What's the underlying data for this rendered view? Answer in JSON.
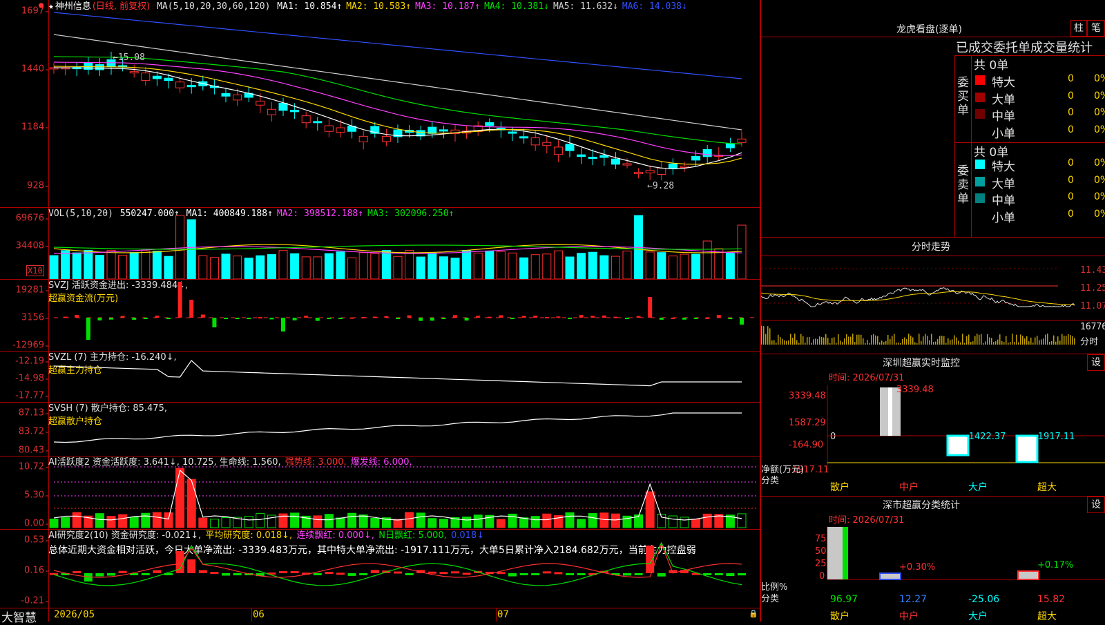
{
  "stock": {
    "name_prefix": "★",
    "name": "神州信息",
    "mode": "(日线, 前复权)",
    "ma_label": "MA(5,10,20,30,60,120)",
    "ma": [
      {
        "label": "MA1: 10.854↑",
        "color": "#ffffff"
      },
      {
        "label": "MA2: 10.583↑",
        "color": "#ffd800"
      },
      {
        "label": "MA3: 10.187↑",
        "color": "#ff40ff"
      },
      {
        "label": "MA4: 10.381↓",
        "color": "#00e000"
      },
      {
        "label": "MA5: 11.632↓",
        "color": "#d0d0d0"
      },
      {
        "label": "MA6: 14.038↓",
        "color": "#3050ff"
      }
    ],
    "high_label": "←15.08",
    "low_label": "←9.28",
    "price_ticks": [
      "1697",
      "1440",
      "1184",
      "928"
    ]
  },
  "vol": {
    "title": "VOL(5,10,20)",
    "value": "550247.000↑",
    "ma": [
      {
        "label": "MA1: 400849.188↑",
        "color": "#ffffff"
      },
      {
        "label": "MA2: 398512.188↑",
        "color": "#ff40ff"
      },
      {
        "label": "MA3: 302096.250↑",
        "color": "#00e000"
      }
    ],
    "ticks": [
      "69676",
      "34408"
    ],
    "unit": "X10"
  },
  "svzj": {
    "title": "SVZJ  活跃资金进出: -3339.484↓,",
    "sub": "超赢资金流(万元)",
    "ticks": [
      "19281",
      "3156",
      "-12969"
    ]
  },
  "svzl": {
    "title": "SVZL (7) 主力持仓: -16.240↓,",
    "sub": "超赢主力持仓",
    "ticks": [
      "-12.19",
      "-14.98",
      "-17.77"
    ]
  },
  "svsh": {
    "title": "SVSH (7) 散户持仓: 85.475,",
    "sub": "超赢散户持仓",
    "ticks": [
      "87.13",
      "83.72",
      "80.43"
    ]
  },
  "ai1": {
    "parts": [
      {
        "t": "AI活跃度2 资金活跃度: 3.641↓, 10.725, 生命线: 1.560,",
        "c": "#e0e0e0"
      },
      {
        "t": "强势线: 3.000,",
        "c": "#ff3030"
      },
      {
        "t": "爆发线: 6.000,",
        "c": "#ff40ff"
      }
    ],
    "ticks": [
      "10.72",
      "5.30",
      "0.00"
    ]
  },
  "ai2": {
    "parts": [
      {
        "t": "AI研究度2(10) 资金研究度: -0.021↓,",
        "c": "#e0e0e0"
      },
      {
        "t": "平均研究度: 0.018↓,",
        "c": "#ffd800"
      },
      {
        "t": "连续飘红: 0.000↓,",
        "c": "#ff40ff"
      },
      {
        "t": "N日飘红: 5.000,",
        "c": "#00e000"
      },
      {
        "t": "0.018↓",
        "c": "#3050ff"
      }
    ],
    "summary": "总体近期大资金相对活跃，今日大单净流出: -3339.483万元，其中特大单净流出: -1917.111万元，大单5日累计净入2184.682万元，当前主力控盘弱",
    "ticks": [
      "0.53",
      "0.16",
      "-0.21"
    ]
  },
  "xaxis": {
    "logo": "大智慧",
    "labels": [
      "2026/05",
      "06",
      "07"
    ]
  },
  "right": {
    "dragon": {
      "title": "龙虎看盘(逐单)",
      "btn_bar": "柱",
      "btn_pen": "笔",
      "tabs": "已成交委托单成交量统计",
      "buy": {
        "side": "委买单",
        "total": "共 0单",
        "rows": [
          {
            "name": "特大",
            "v1": "0",
            "v2": "0%",
            "color": "#ff0000"
          },
          {
            "name": "大单",
            "v1": "0",
            "v2": "0%",
            "color": "#a00000"
          },
          {
            "name": "中单",
            "v1": "0",
            "v2": "0%",
            "color": "#700000"
          },
          {
            "name": "小单",
            "v1": "0",
            "v2": "0%",
            "color": "#000000"
          }
        ]
      },
      "sell": {
        "side": "委卖单",
        "total": "共 0单",
        "rows": [
          {
            "name": "特大",
            "v1": "0",
            "v2": "0%",
            "color": "#00ffff"
          },
          {
            "name": "大单",
            "v1": "0",
            "v2": "0%",
            "color": "#00a0a0"
          },
          {
            "name": "中单",
            "v1": "0",
            "v2": "0%",
            "color": "#008080"
          },
          {
            "name": "小单",
            "v1": "0",
            "v2": "0%",
            "color": "#000000"
          }
        ]
      }
    },
    "intraday": {
      "title": "分时走势",
      "ticks": [
        "11.43",
        "11.25",
        "11.07"
      ],
      "vol_top": "16776",
      "vol_label": "分时"
    },
    "monitor": {
      "title": "深圳超赢实时监控",
      "btn": "设",
      "time": "时间: 2026/07/31",
      "ticks": [
        "3339.48",
        "1587.29",
        "-164.90",
        "-1917.11"
      ],
      "zero": "0",
      "net_label": "净额(万元)",
      "cat_label": "分类",
      "cats": [
        {
          "name": "散户",
          "color": "#ffd800",
          "value": ""
        },
        {
          "name": "中户",
          "color": "#ff3030",
          "value": "3339.48"
        },
        {
          "name": "大户",
          "color": "#00ffff",
          "value": "-1422.37"
        },
        {
          "name": "超大",
          "color": "#ffd800",
          "value": "-1917.11"
        }
      ]
    },
    "classify": {
      "title": "深市超赢分类统计",
      "btn": "设",
      "time": "时间: 2026/07/31",
      "ticks": [
        "75",
        "50",
        "25",
        "0"
      ],
      "ratio_label": "比例%",
      "cat_label": "分类",
      "cats": [
        {
          "name": "散户",
          "color": "#ffd800",
          "value": "96.97",
          "value_color": "#00e000",
          "pct": ""
        },
        {
          "name": "中户",
          "color": "#ff3030",
          "value": "12.27",
          "value_color": "#3080ff",
          "pct": "+0.30%"
        },
        {
          "name": "大户",
          "color": "#00ffff",
          "value": "-25.06",
          "value_color": "#00ffff",
          "pct": ""
        },
        {
          "name": "超大",
          "color": "#ffd800",
          "value": "15.82",
          "value_color": "#ff3030",
          "pct": "+0.17%"
        }
      ]
    }
  }
}
